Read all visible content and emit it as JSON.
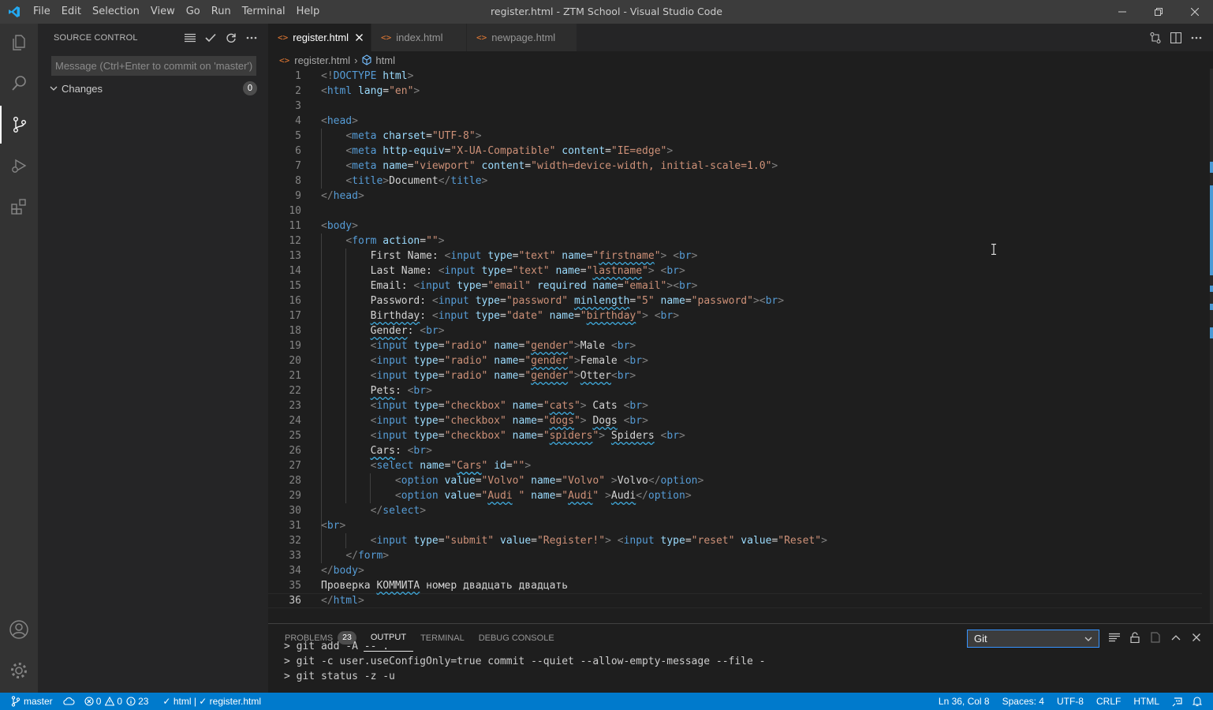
{
  "window": {
    "title": "register.html - ZTM School - Visual Studio Code",
    "menu": [
      "File",
      "Edit",
      "Selection",
      "View",
      "Go",
      "Run",
      "Terminal",
      "Help"
    ]
  },
  "sidebar": {
    "title": "SOURCE CONTROL",
    "commit_placeholder": "Message (Ctrl+Enter to commit on 'master')",
    "changes_label": "Changes",
    "changes_count": "0"
  },
  "tabs": [
    {
      "label": "register.html",
      "active": true
    },
    {
      "label": "index.html",
      "active": false
    },
    {
      "label": "newpage.html",
      "active": false
    }
  ],
  "breadcrumbs": {
    "file": "register.html",
    "symbol": "html"
  },
  "editor": {
    "line_numbers": [
      "1",
      "2",
      "3",
      "4",
      "5",
      "6",
      "7",
      "8",
      "9",
      "10",
      "11",
      "12",
      "13",
      "14",
      "15",
      "16",
      "17",
      "18",
      "19",
      "20",
      "21",
      "22",
      "23",
      "24",
      "25",
      "26",
      "27",
      "28",
      "29",
      "30",
      "31",
      "32",
      "33",
      "34",
      "35",
      "36"
    ],
    "current_line": "36"
  },
  "panel": {
    "tabs": {
      "problems": "PROBLEMS",
      "problems_count": "23",
      "output": "OUTPUT",
      "terminal": "TERMINAL",
      "debug": "DEBUG CONSOLE"
    },
    "output_channel": "Git",
    "output_lines": [
      "> git add -A -- .",
      "> git -c user.useConfigOnly=true commit --quiet --allow-empty-message --file -",
      "> git status -z -u"
    ]
  },
  "statusbar": {
    "branch": "master",
    "errors": "0",
    "warnings": "0",
    "infos": "23",
    "language_check": "html",
    "file_check": "register.html",
    "position": "Ln 36, Col 8",
    "spaces": "Spaces: 4",
    "encoding": "UTF-8",
    "eol": "CRLF",
    "language": "HTML"
  },
  "colors": {
    "statusbar": "#007acc",
    "activity_bar": "#333333",
    "sidebar": "#252526",
    "editor": "#1e1e1e",
    "tag": "#569cd6",
    "attribute": "#9cdcfe",
    "string": "#ce9178"
  }
}
